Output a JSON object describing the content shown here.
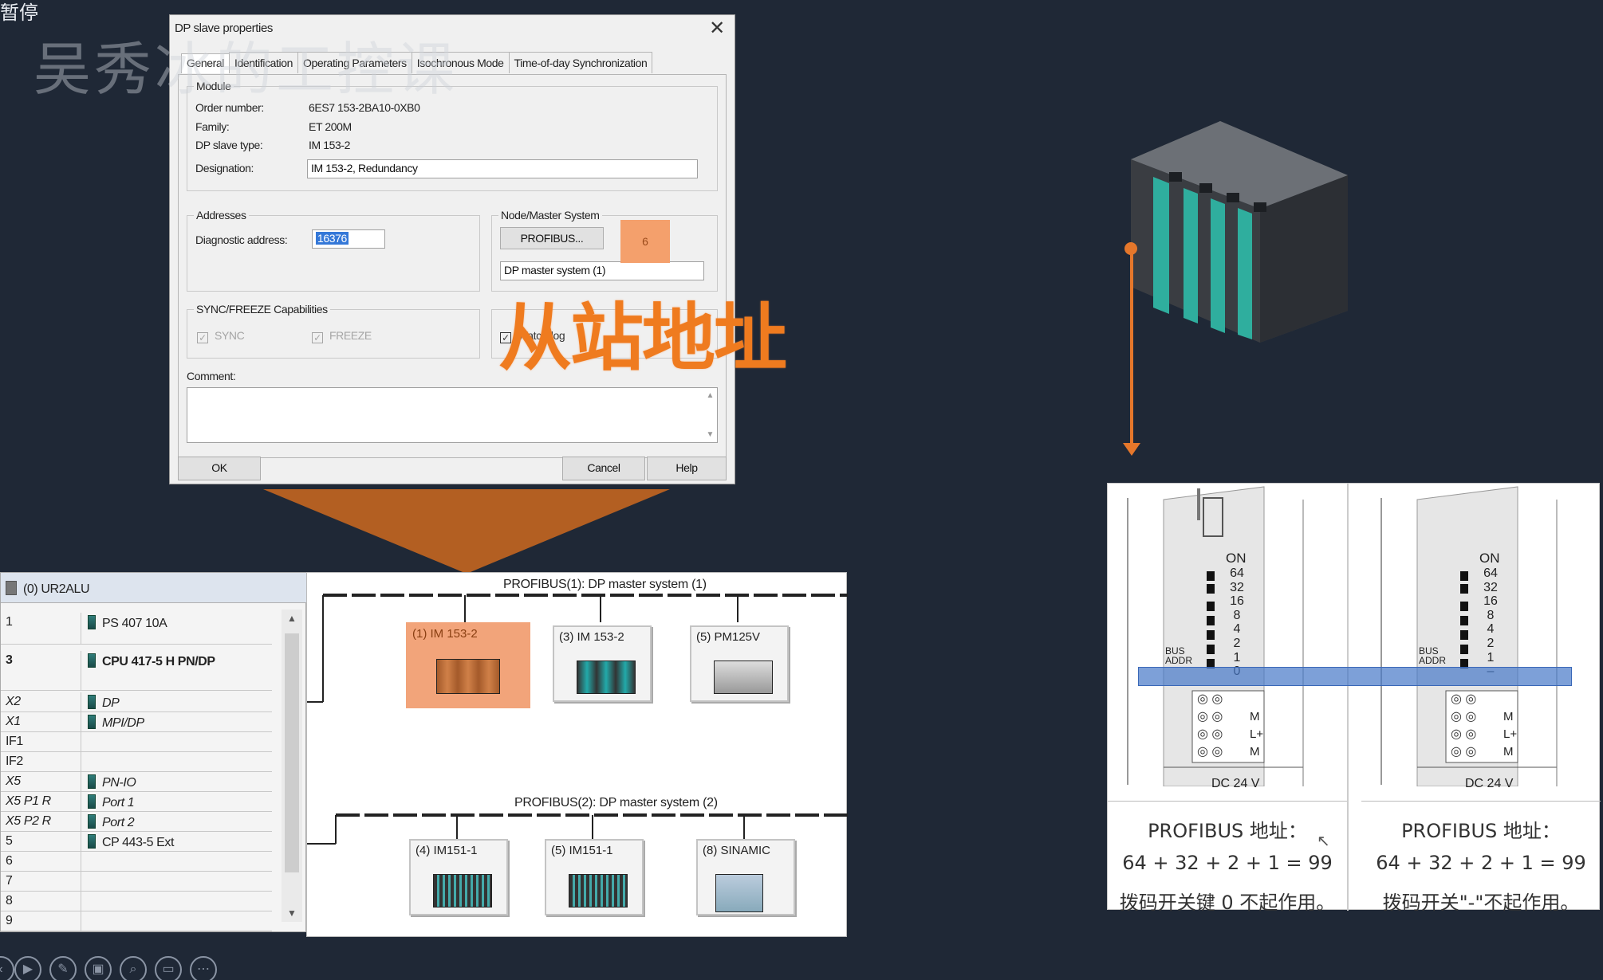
{
  "overlay": {
    "paused_label": "暂停",
    "watermark": "吴秀冰的工控课",
    "caption": "从站地址"
  },
  "dialog": {
    "title": "DP slave properties",
    "tabs": [
      "General",
      "Identification",
      "Operating Parameters",
      "Isochronous Mode",
      "Time-of-day Synchronization"
    ],
    "active_tab": "General",
    "module": {
      "group_label": "Module",
      "order_number_label": "Order number:",
      "order_number": "6ES7 153-2BA10-0XB0",
      "family_label": "Family:",
      "family": "ET 200M",
      "slave_type_label": "DP slave type:",
      "slave_type": "IM 153-2",
      "designation_label": "Designation:",
      "designation": "IM 153-2, Redundancy"
    },
    "addresses": {
      "group_label": "Addresses",
      "diag_label": "Diagnostic address:",
      "diag_value": "16376"
    },
    "node": {
      "group_label": "Node/Master System",
      "profibus_button": "PROFIBUS...",
      "node_address": "6",
      "master_system": "DP master system (1)"
    },
    "sync": {
      "group_label": "SYNC/FREEZE Capabilities",
      "sync_label": "SYNC",
      "freeze_label": "FREEZE",
      "watchdog_label": "Watchdog"
    },
    "comment_label": "Comment:",
    "buttons": {
      "ok": "OK",
      "cancel": "Cancel",
      "help": "Help"
    }
  },
  "rack": {
    "title": "(0) UR2ALU",
    "rows": [
      {
        "slot": "1",
        "module": "PS 407 10A"
      },
      {
        "slot": "3",
        "module": "CPU 417-5 H PN/DP"
      },
      {
        "slot": "X2",
        "module": "DP"
      },
      {
        "slot": "X1",
        "module": "MPI/DP"
      },
      {
        "slot": "IF1",
        "module": ""
      },
      {
        "slot": "IF2",
        "module": ""
      },
      {
        "slot": "X5",
        "module": "PN-IO"
      },
      {
        "slot": "X5 P1 R",
        "module": "Port 1"
      },
      {
        "slot": "X5 P2 R",
        "module": "Port 2"
      },
      {
        "slot": "5",
        "module": "CP 443-5 Ext"
      },
      {
        "slot": "6",
        "module": ""
      },
      {
        "slot": "7",
        "module": ""
      },
      {
        "slot": "8",
        "module": ""
      },
      {
        "slot": "9",
        "module": ""
      }
    ]
  },
  "network": {
    "bus1": "PROFIBUS(1): DP master system (1)",
    "bus2": "PROFIBUS(2): DP master system (2)",
    "bus1_devices": [
      "(1) IM 153-2",
      "(3) IM 153-2",
      "(5) PM125V"
    ],
    "bus2_devices": [
      "(4) IM151-1",
      "(5) IM151-1",
      "(8) SINAMIC"
    ]
  },
  "dip": {
    "on_label": "ON",
    "weights": [
      "64",
      "32",
      "16",
      "8",
      "4",
      "2",
      "1"
    ],
    "bottom_left": "0",
    "bottom_right": "–",
    "bus_addr": "BUS ADDR",
    "terminals": [
      "M",
      "L+",
      "M"
    ],
    "dc_label": "DC 24 V",
    "caption_title": "PROFIBUS 地址：",
    "caption_formula": "64 + 32 + 2 + 1 = 99",
    "caption_left_note": "拨码开关键 0 不起作用。",
    "caption_right_note": "拨码开关\"-\"不起作用。"
  },
  "toolbar": [
    "play-icon",
    "pen-icon",
    "save-icon",
    "zoom-icon",
    "screen-icon",
    "more-icon"
  ],
  "colors": {
    "accent_orange": "#ef7b1f",
    "background": "#1f2836",
    "selection": "#f2a47a"
  }
}
